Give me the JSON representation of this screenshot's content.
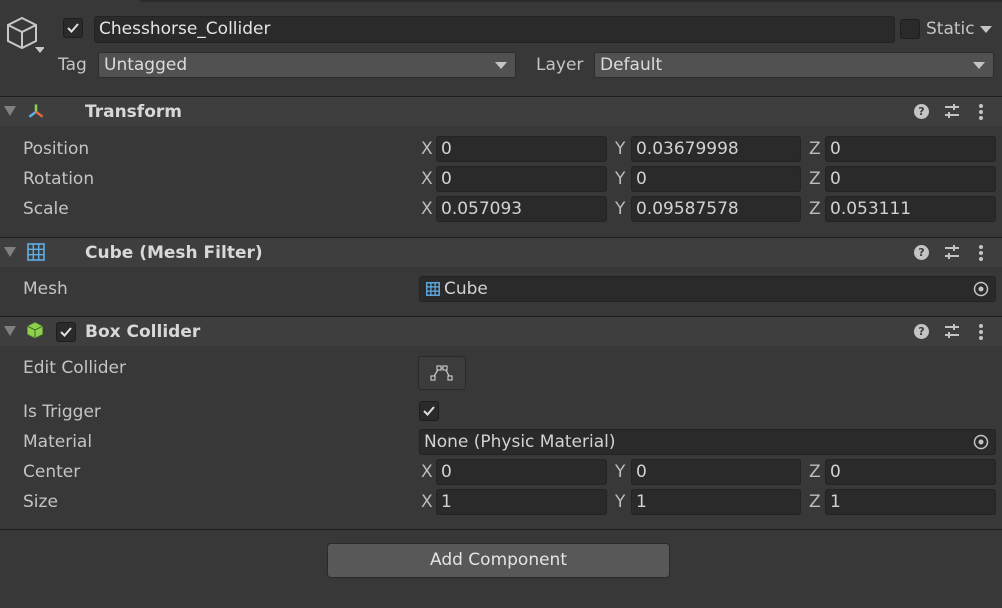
{
  "object": {
    "name": "Chesshorse_Collider",
    "static_label": "Static",
    "tag_label": "Tag",
    "tag_value": "Untagged",
    "layer_label": "Layer",
    "layer_value": "Default"
  },
  "transform": {
    "title": "Transform",
    "rows": [
      {
        "label": "Position",
        "x": "0",
        "y": "0.03679998",
        "z": "0"
      },
      {
        "label": "Rotation",
        "x": "0",
        "y": "0",
        "z": "0"
      },
      {
        "label": "Scale",
        "x": "0.057093",
        "y": "0.09587578",
        "z": "0.053111"
      }
    ]
  },
  "axes": {
    "x": "X",
    "y": "Y",
    "z": "Z"
  },
  "mesh_filter": {
    "title": "Cube (Mesh Filter)",
    "mesh_label": "Mesh",
    "mesh_value": "Cube"
  },
  "box_collider": {
    "title": "Box Collider",
    "edit_collider_label": "Edit Collider",
    "is_trigger_label": "Is Trigger",
    "material_label": "Material",
    "material_value": "None (Physic Material)",
    "rows": [
      {
        "label": "Center",
        "x": "0",
        "y": "0",
        "z": "0"
      },
      {
        "label": "Size",
        "x": "1",
        "y": "1",
        "z": "1"
      }
    ]
  },
  "add_component_label": "Add Component",
  "colors": {
    "background": "#383838",
    "header": "#3e3e3e",
    "field": "#2a2a2a",
    "collider_icon": "#8fd14f",
    "grid_icon": "#5fb0e8"
  },
  "icons": [
    "gameobject-cube-icon",
    "transform-axes-icon",
    "mesh-grid-icon",
    "box-collider-icon",
    "help-icon",
    "presets-sliders-icon",
    "kebab-menu-icon",
    "object-picker-icon",
    "edit-collider-icon",
    "checkmark-icon"
  ]
}
